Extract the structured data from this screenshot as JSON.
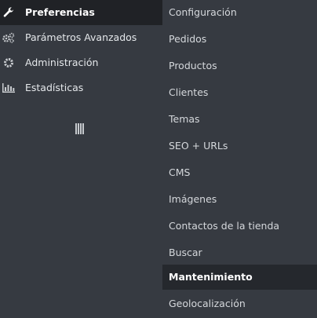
{
  "sidebar": {
    "items": [
      {
        "label": "Preferencias",
        "icon": "wrench-icon",
        "active": true
      },
      {
        "label": "Parámetros Avanzados",
        "icon": "cogs-icon",
        "active": false
      },
      {
        "label": "Administración",
        "icon": "gear-icon",
        "active": false
      },
      {
        "label": "Estadísticas",
        "icon": "bar-chart-icon",
        "active": false
      }
    ],
    "collapse_icon": "collapse-handle-icon"
  },
  "submenu": {
    "items": [
      {
        "label": "Configuración"
      },
      {
        "label": "Pedidos"
      },
      {
        "label": "Productos"
      },
      {
        "label": "Clientes"
      },
      {
        "label": "Temas"
      },
      {
        "label": "SEO + URLs"
      },
      {
        "label": "CMS"
      },
      {
        "label": "Imágenes"
      },
      {
        "label": "Contactos de la tienda"
      },
      {
        "label": "Buscar"
      },
      {
        "label": "Mantenimiento",
        "highlighted": true
      },
      {
        "label": "Geolocalización"
      }
    ]
  },
  "colors": {
    "background": "#363a41",
    "active_item": "#202226",
    "highlight_item": "#25282d",
    "text": "#e5e8eb"
  }
}
